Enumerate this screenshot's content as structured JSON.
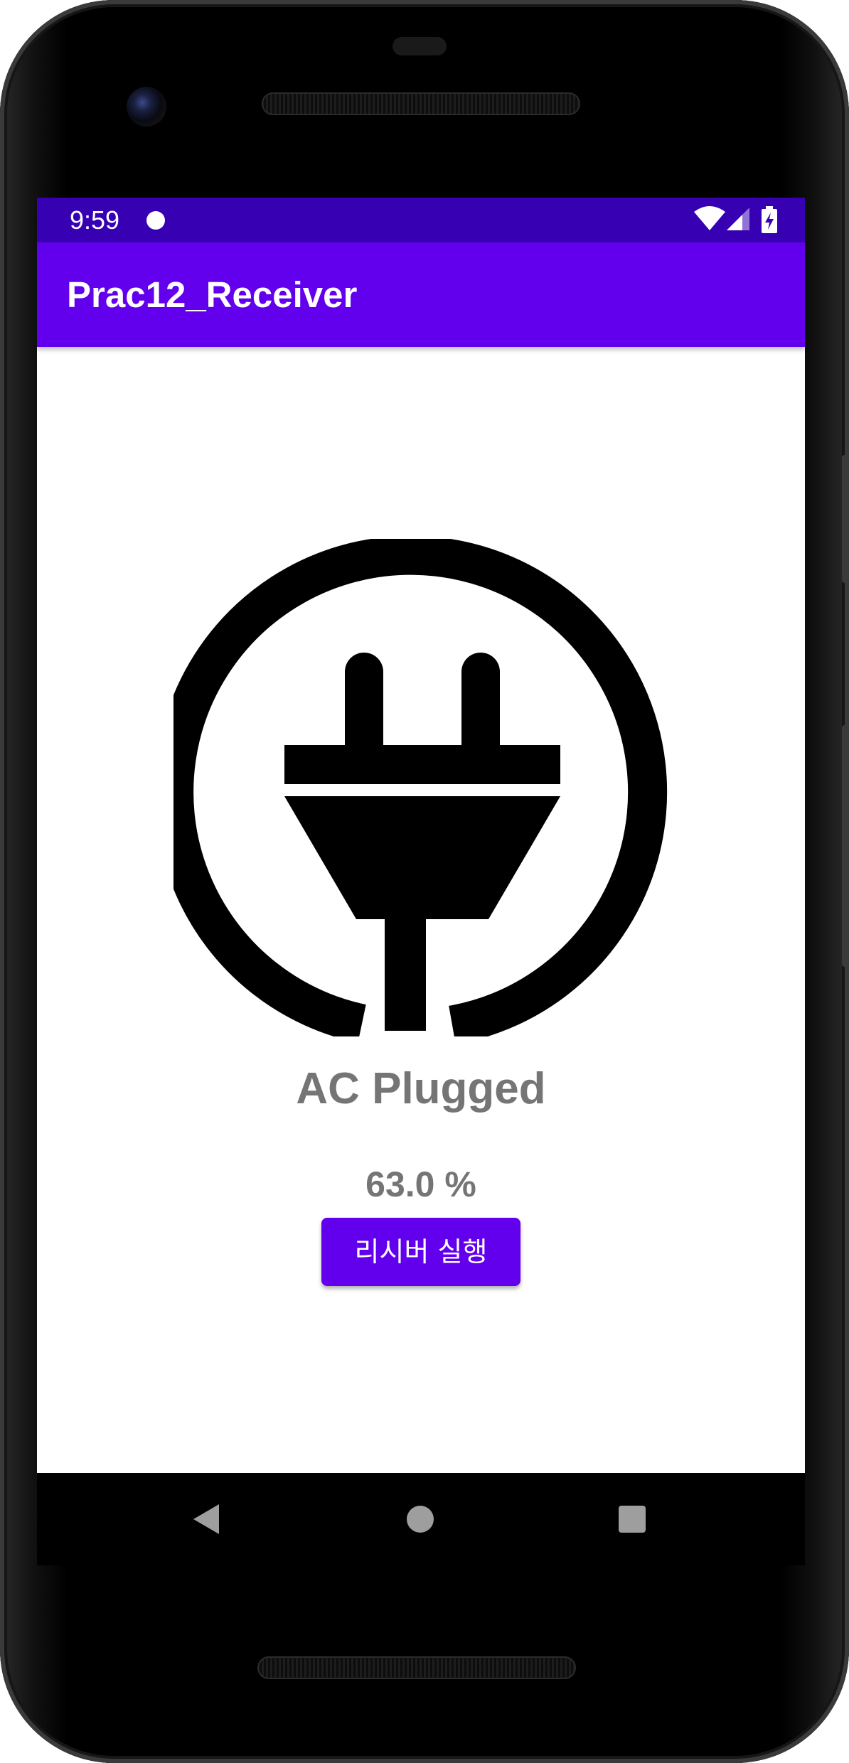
{
  "status_bar": {
    "time": "9:59",
    "icons": [
      "notification-dot-icon",
      "wifi-icon",
      "cell-signal-icon",
      "battery-charging-icon"
    ]
  },
  "app_bar": {
    "title": "Prac12_Receiver"
  },
  "main": {
    "image_icon": "power-plug-icon",
    "charge_status": "AC Plugged",
    "battery_level": "63.0 %",
    "receiver_button_label": "리시버 실행"
  },
  "nav_bar": {
    "icons": [
      "back-icon",
      "home-icon",
      "recents-icon"
    ]
  },
  "colors": {
    "status_bar": "#3700b3",
    "app_bar": "#6200ee",
    "button": "#6200ee",
    "text_gray": "#757575"
  }
}
